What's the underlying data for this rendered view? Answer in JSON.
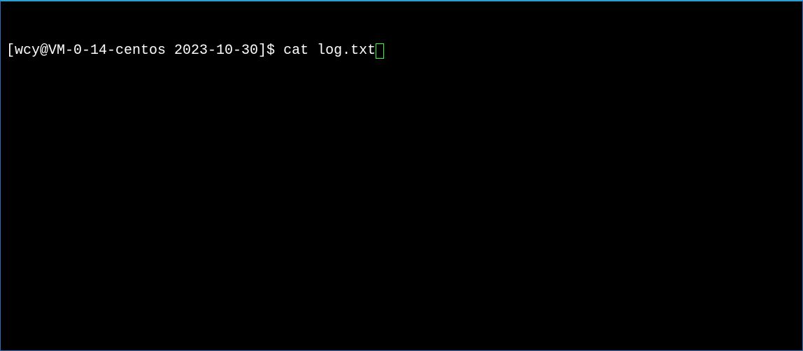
{
  "terminal": {
    "prompt": "[wcy@VM-0-14-centos 2023-10-30]$ ",
    "command": "cat log.txt"
  }
}
